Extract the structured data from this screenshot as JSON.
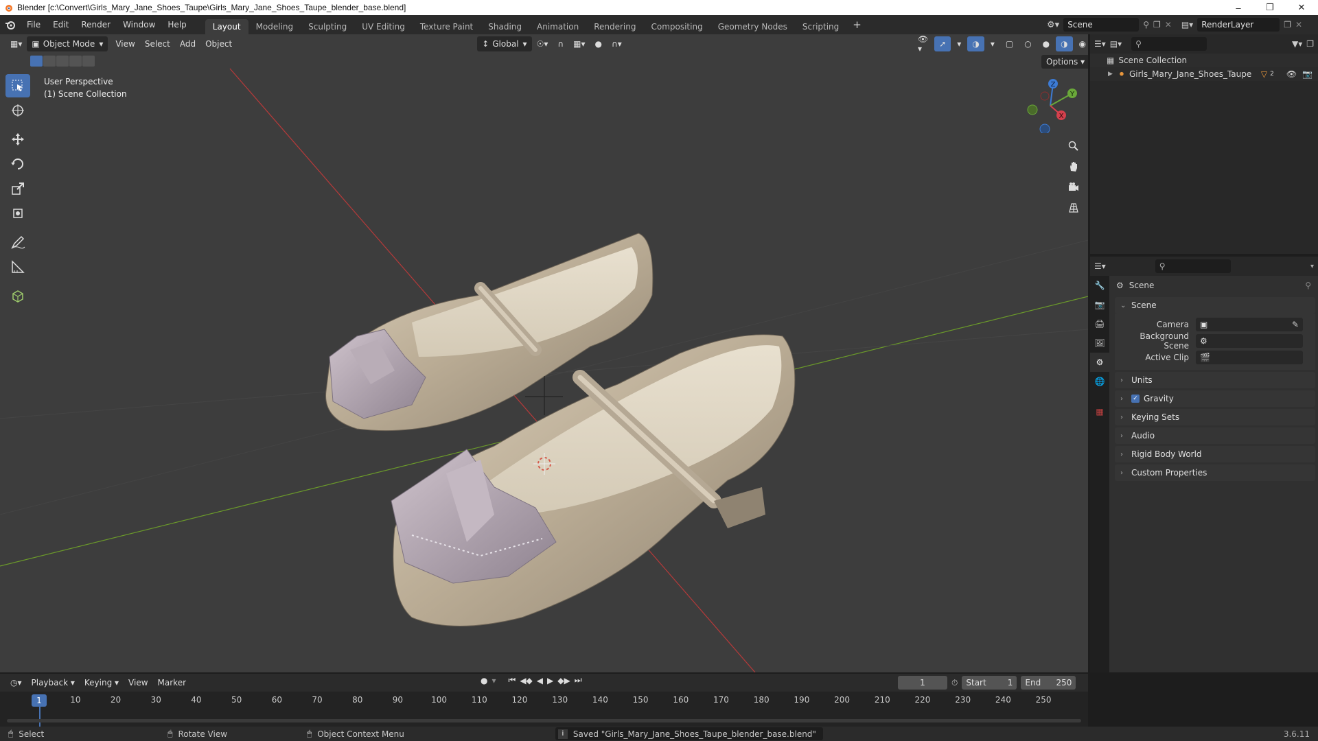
{
  "window": {
    "title": "Blender [c:\\Convert\\Girls_Mary_Jane_Shoes_Taupe\\Girls_Mary_Jane_Shoes_Taupe_blender_base.blend]"
  },
  "menus": [
    "File",
    "Edit",
    "Render",
    "Window",
    "Help"
  ],
  "workspaces": [
    "Layout",
    "Modeling",
    "Sculpting",
    "UV Editing",
    "Texture Paint",
    "Shading",
    "Animation",
    "Rendering",
    "Compositing",
    "Geometry Nodes",
    "Scripting"
  ],
  "active_workspace": "Layout",
  "scene_name": "Scene",
  "render_layer": "RenderLayer",
  "viewport": {
    "mode": "Object Mode",
    "menu": [
      "View",
      "Select",
      "Add",
      "Object"
    ],
    "orientation": "Global",
    "options_label": "Options",
    "overlay_line1": "User Perspective",
    "overlay_line2": "(1) Scene Collection",
    "gizmo_labels": {
      "z": "Z",
      "y": "Y",
      "x": "X"
    }
  },
  "outliner": {
    "root": "Scene Collection",
    "items": [
      {
        "name": "Girls_Mary_Jane_Shoes_Taupe",
        "badge": "2"
      }
    ]
  },
  "properties": {
    "header": "Scene",
    "section": "Scene",
    "fields": [
      {
        "label": "Camera",
        "value": ""
      },
      {
        "label": "Background Scene",
        "value": ""
      },
      {
        "label": "Active Clip",
        "value": ""
      }
    ],
    "panels": [
      {
        "label": "Units",
        "checkbox": false
      },
      {
        "label": "Gravity",
        "checkbox": true
      },
      {
        "label": "Keying Sets",
        "checkbox": false
      },
      {
        "label": "Audio",
        "checkbox": false
      },
      {
        "label": "Rigid Body World",
        "checkbox": false
      },
      {
        "label": "Custom Properties",
        "checkbox": false
      }
    ]
  },
  "timeline": {
    "menu": [
      "Playback",
      "Keying",
      "View",
      "Marker"
    ],
    "current_frame": "1",
    "start_label": "Start",
    "start": "1",
    "end_label": "End",
    "end": "250",
    "ticks": [
      "10",
      "20",
      "30",
      "40",
      "50",
      "60",
      "70",
      "80",
      "90",
      "100",
      "110",
      "120",
      "130",
      "140",
      "150",
      "160",
      "170",
      "180",
      "190",
      "200",
      "210",
      "220",
      "230",
      "240",
      "250"
    ]
  },
  "statusbar": {
    "select": "Select",
    "rotate": "Rotate View",
    "context": "Object Context Menu",
    "message": "Saved \"Girls_Mary_Jane_Shoes_Taupe_blender_base.blend\"",
    "version": "3.6.11"
  },
  "colors": {
    "accent": "#4772b3",
    "viewport_bg": "#3d3d3d",
    "shoe": "#c9bca6",
    "bow": "#a89aa4",
    "x_axis": "#b83a3a",
    "y_axis": "#6b9a2a"
  }
}
